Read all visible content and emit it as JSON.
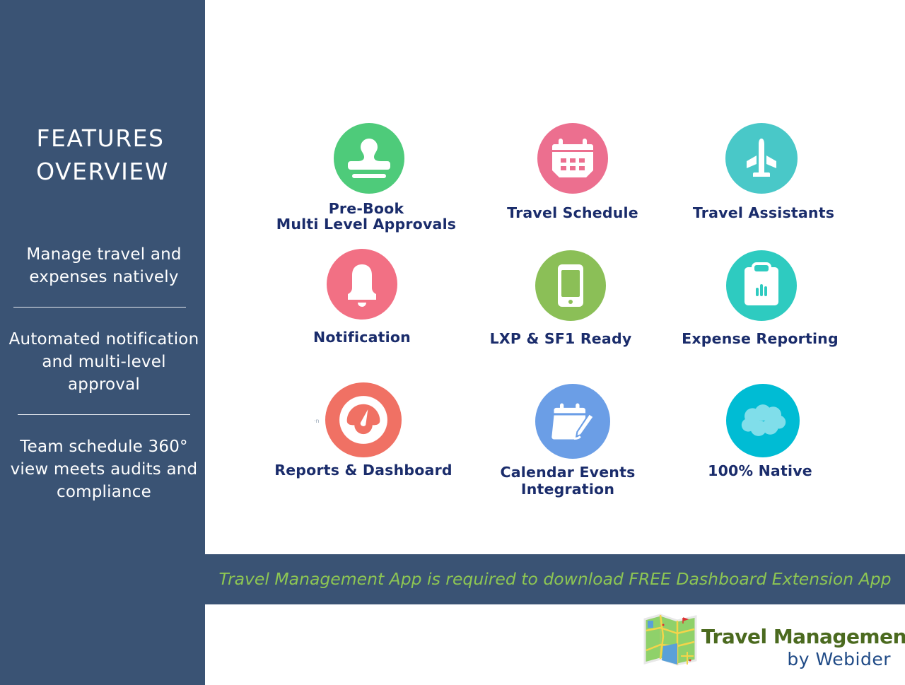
{
  "sidebar": {
    "title_line1": "FEATURES",
    "title_line2": "OVERVIEW",
    "blocks": [
      {
        "lines": [
          "Manage travel and",
          "expenses natively"
        ]
      },
      {
        "lines": [
          "Automated notification",
          "and multi-level",
          "approval"
        ]
      },
      {
        "lines": [
          "Team schedule 360°",
          "view meets audits and",
          "compliance"
        ]
      }
    ]
  },
  "features": [
    {
      "label_lines": [
        "Pre-Book",
        "Multi Level Approvals"
      ],
      "icon": "stamp-icon",
      "color": "#4ecb7a"
    },
    {
      "label_lines": [
        "Travel Schedule"
      ],
      "icon": "calendar-icon",
      "color": "#ec6f8f"
    },
    {
      "label_lines": [
        "Travel Assistants"
      ],
      "icon": "airplane-icon",
      "color": "#49c8c8"
    },
    {
      "label_lines": [
        "Notification"
      ],
      "icon": "bell-icon",
      "color": "#f27084"
    },
    {
      "label_lines": [
        "LXP & SF1 Ready"
      ],
      "icon": "mobile-phone-icon",
      "color": "#8bbf57"
    },
    {
      "label_lines": [
        "Expense Reporting"
      ],
      "icon": "clipboard-chart-icon",
      "color": "#2ecbc0"
    },
    {
      "label_lines": [
        "Reports & Dashboard"
      ],
      "icon": "gauge-icon",
      "color": "#f07164"
    },
    {
      "label_lines": [
        "Calendar Events",
        "Integration"
      ],
      "icon": "calendar-edit-icon",
      "color": "#6b9ee6"
    },
    {
      "label_lines": [
        "100% Native"
      ],
      "icon": "cloud-icon",
      "color": "#00bcd4"
    }
  ],
  "banner": {
    "text": "Travel Management App is required to download FREE Dashboard Extension App",
    "color": "#8dc653"
  },
  "logo": {
    "title": "Travel Management",
    "subtitle": "by Webider"
  },
  "colors": {
    "sidebar_bg": "#3a5374",
    "label_text": "#1a2c6b"
  }
}
